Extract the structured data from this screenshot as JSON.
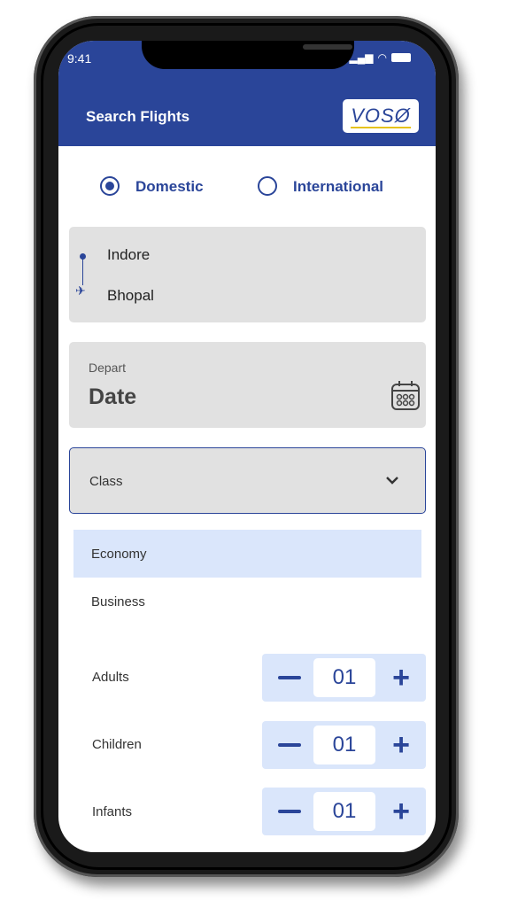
{
  "status_bar": {
    "time": "9:41"
  },
  "header": {
    "title": "Search Flights",
    "logo": "VOSØ"
  },
  "trip_type": {
    "options": [
      "Domestic",
      "International"
    ],
    "selected": "Domestic"
  },
  "route": {
    "from": "Indore",
    "to": "Bhopal"
  },
  "depart": {
    "label": "Depart",
    "value": "Date"
  },
  "class_select": {
    "placeholder": "Class",
    "options": [
      "Economy",
      "Business"
    ],
    "highlighted": "Economy"
  },
  "passengers": [
    {
      "label": "Adults",
      "value": "01"
    },
    {
      "label": "Children",
      "value": "01"
    },
    {
      "label": "Infants",
      "value": "01"
    }
  ],
  "colors": {
    "primary": "#2a4599",
    "field": "#e1e1e1",
    "highlight": "#dae6fb"
  }
}
